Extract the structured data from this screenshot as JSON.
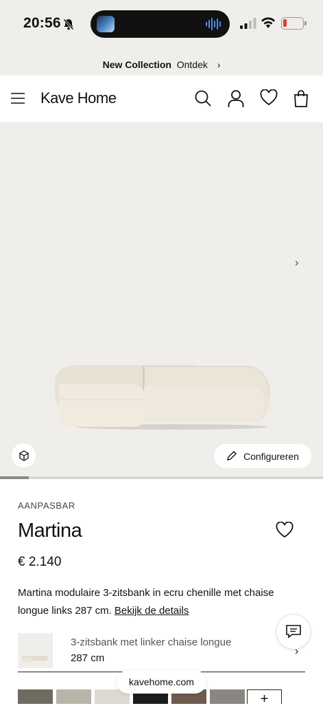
{
  "status_bar": {
    "time": "20:56"
  },
  "promo": {
    "bold": "New Collection",
    "link": "Ontdek"
  },
  "header": {
    "logo": "Kave Home"
  },
  "gallery": {
    "configure_label": "Configureren",
    "progress": 0.09
  },
  "product": {
    "tag": "AANPASBAR",
    "name": "Martina",
    "price": "€ 2.140",
    "description": "Martina modulaire 3-zitsbank in ecru chenille met chaise longue links 287 cm.",
    "details_link": "Bekijk de details"
  },
  "variant": {
    "name": "3-zitsbank met linker chaise longue",
    "size": "287 cm"
  },
  "swatches": {
    "colors": [
      "#6f6b5e",
      "#b9b4a8",
      "#dcd9d2",
      "#1c1c1c",
      "#6e5a4e",
      "#8a8681"
    ],
    "add_label": "+"
  },
  "browser": {
    "url": "kavehome.com"
  }
}
